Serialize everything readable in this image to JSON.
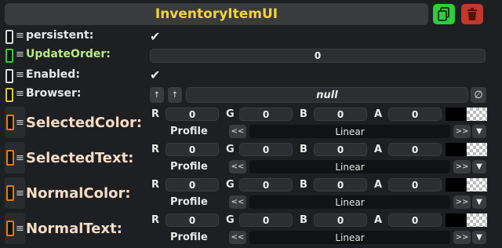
{
  "header": {
    "title": "InventoryItemUI",
    "copy_icon": "copy-icon",
    "delete_icon": "trash-icon"
  },
  "props": {
    "persistent": {
      "label": "persistent:",
      "checked": true
    },
    "update_order": {
      "label": "UpdateOrder:",
      "value": "0"
    },
    "enabled": {
      "label": "Enabled:",
      "checked": true
    },
    "browser": {
      "label": "Browser:",
      "value": "null",
      "btn_up1": "↑",
      "btn_up2": "↑",
      "clear_glyph": "∅"
    }
  },
  "color_rows": [
    {
      "label": "SelectedColor:",
      "r": "0",
      "g": "0",
      "b": "0",
      "a": "0",
      "profile_label": "Profile",
      "profile_value": "Linear",
      "prev": "<<",
      "next": ">>",
      "dd": "▼"
    },
    {
      "label": "SelectedText:",
      "r": "0",
      "g": "0",
      "b": "0",
      "a": "0",
      "profile_label": "Profile",
      "profile_value": "Linear",
      "prev": "<<",
      "next": ">>",
      "dd": "▼"
    },
    {
      "label": "NormalColor:",
      "r": "0",
      "g": "0",
      "b": "0",
      "a": "0",
      "profile_label": "Profile",
      "profile_value": "Linear",
      "prev": "<<",
      "next": ">>",
      "dd": "▼"
    },
    {
      "label": "NormalText:",
      "r": "0",
      "g": "0",
      "b": "0",
      "a": "0",
      "profile_label": "Profile",
      "profile_value": "Linear",
      "prev": "<<",
      "next": ">>",
      "dd": "▼"
    }
  ],
  "channels": {
    "r": "R",
    "g": "G",
    "b": "B",
    "a": "A"
  },
  "colors": {
    "title": "#f2d43a",
    "grip_default": "#d9d9d9",
    "grip_green": "#2ecc40",
    "grip_yellow": "#d4c94a",
    "grip_orange": "#e07b12",
    "copy": "#2ecc40",
    "delete": "#c0392b"
  }
}
